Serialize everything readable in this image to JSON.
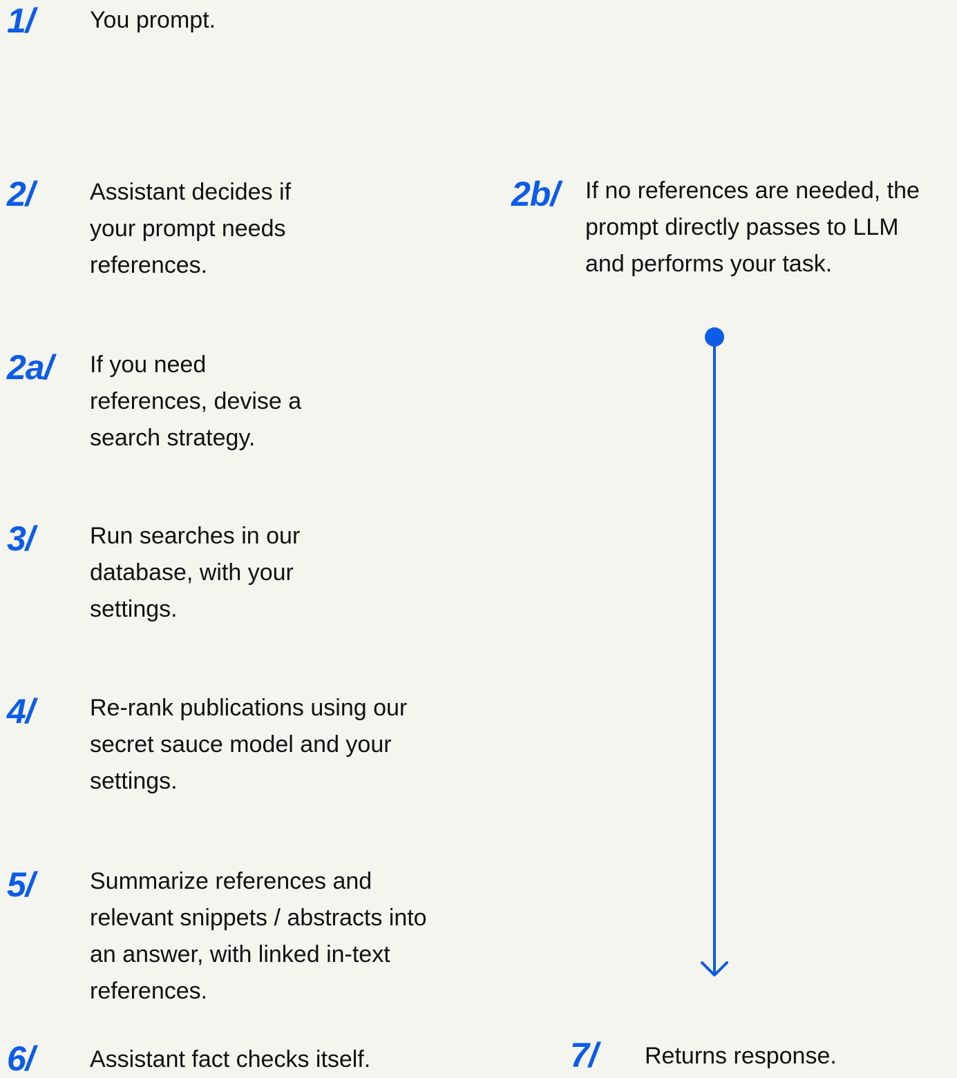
{
  "accent_color": "#0d5ce8",
  "steps": [
    {
      "id": "1",
      "label": "1/",
      "text": "You prompt."
    },
    {
      "id": "2",
      "label": "2/",
      "text": "Assistant decides if\nyour prompt needs\nreferences."
    },
    {
      "id": "2b",
      "label": "2b/",
      "text": "If no references are needed, the\nprompt directly passes to LLM\nand performs your task."
    },
    {
      "id": "2a",
      "label": "2a/",
      "text": "If you need\nreferences, devise a\nsearch strategy."
    },
    {
      "id": "3",
      "label": "3/",
      "text": "Run searches in our\ndatabase, with your\nsettings."
    },
    {
      "id": "4",
      "label": "4/",
      "text": "Re-rank publications using our\nsecret sauce model and your\nsettings."
    },
    {
      "id": "5",
      "label": "5/",
      "text": "Summarize references and\nrelevant snippets / abstracts into\nan answer, with linked in-text\nreferences."
    },
    {
      "id": "6",
      "label": "6/",
      "text": "Assistant fact checks itself."
    },
    {
      "id": "7",
      "label": "7/",
      "text": "Returns response."
    }
  ],
  "connectors": [
    {
      "from": "2b",
      "to": "7",
      "icon": "arrow-down-icon"
    }
  ]
}
